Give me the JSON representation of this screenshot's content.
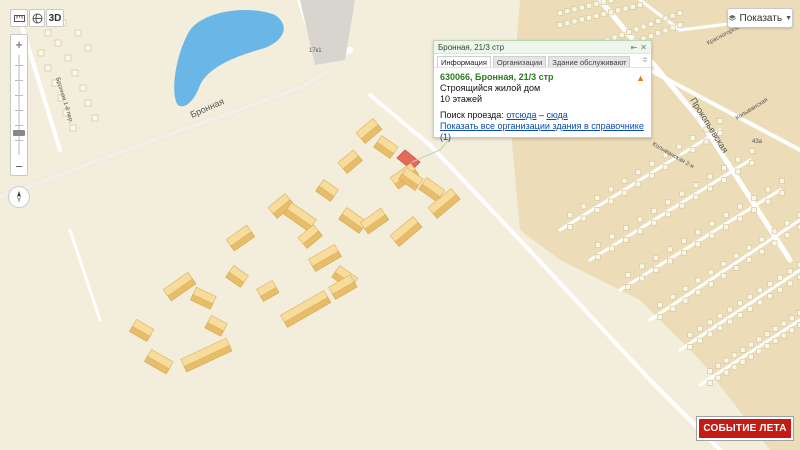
{
  "toolbar": {
    "d3_label": "3D"
  },
  "zoom": {
    "plus": "+",
    "minus": "−",
    "level_fraction": 0.22
  },
  "show_button": {
    "label": "Показать",
    "icon": "layers-icon"
  },
  "balloon": {
    "header_title": "Бронная, 21/3 стр",
    "tabs": [
      "Информация",
      "Организации",
      "Здание обслуживают"
    ],
    "address": "630066, Бронная, 21/3 стр",
    "status": "Строящийся жилой дом",
    "floors": "10 этажей",
    "route_prefix": "Поиск проезда:",
    "route_from": "отсюда",
    "route_dash": " – ",
    "route_to": "сюда",
    "all_orgs_link": "Показать все организации здания в справочнике",
    "all_orgs_count": "(1)"
  },
  "map_labels": {
    "bronnaya": "Бронная",
    "bronnaya_vertical": "Бронная 1-й пер.",
    "prokopievskaya": "Прокопьевская",
    "krasnogorskaya": "Красногорская",
    "kolyvanskaya": "Колыванская",
    "kolyvanskaya_2": "Колыванская 2-я",
    "house_num": "17к1",
    "house_43a": "43а"
  },
  "promo": {
    "label": "СОБЫТИЕ ЛЕТА",
    "color": "#c41b14"
  },
  "colors": {
    "background": "#f2ecd8",
    "water": "#6ab6e6",
    "building": "#f4d38e",
    "highlight": "#e66a5c",
    "road": "#ffffff",
    "suburb": "#ead7b0"
  }
}
